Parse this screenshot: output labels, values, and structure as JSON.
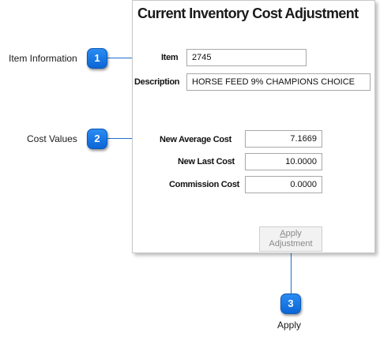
{
  "dialog": {
    "title": "Current Inventory Cost Adjustment",
    "item_label": "Item",
    "item_value": "2745",
    "description_label": "Description",
    "description_value": "HORSE FEED 9% CHAMPIONS CHOICE",
    "new_average_cost_label": "New Average Cost",
    "new_average_cost_value": "7.1669",
    "new_last_cost_label": "New Last Cost",
    "new_last_cost_value": "10.0000",
    "commission_cost_label": "Commission Cost",
    "commission_cost_value": "0.0000",
    "apply_button": {
      "mnemonic": "A",
      "line1_rest": "pply",
      "line2": "Adjustment",
      "enabled": false
    }
  },
  "callouts": [
    {
      "number": "1",
      "label": "Item Information"
    },
    {
      "number": "2",
      "label": "Cost Values"
    },
    {
      "number": "3",
      "label": "Apply"
    }
  ],
  "colors": {
    "badge": "#1a7be6",
    "leader": "#1f6fc9"
  }
}
